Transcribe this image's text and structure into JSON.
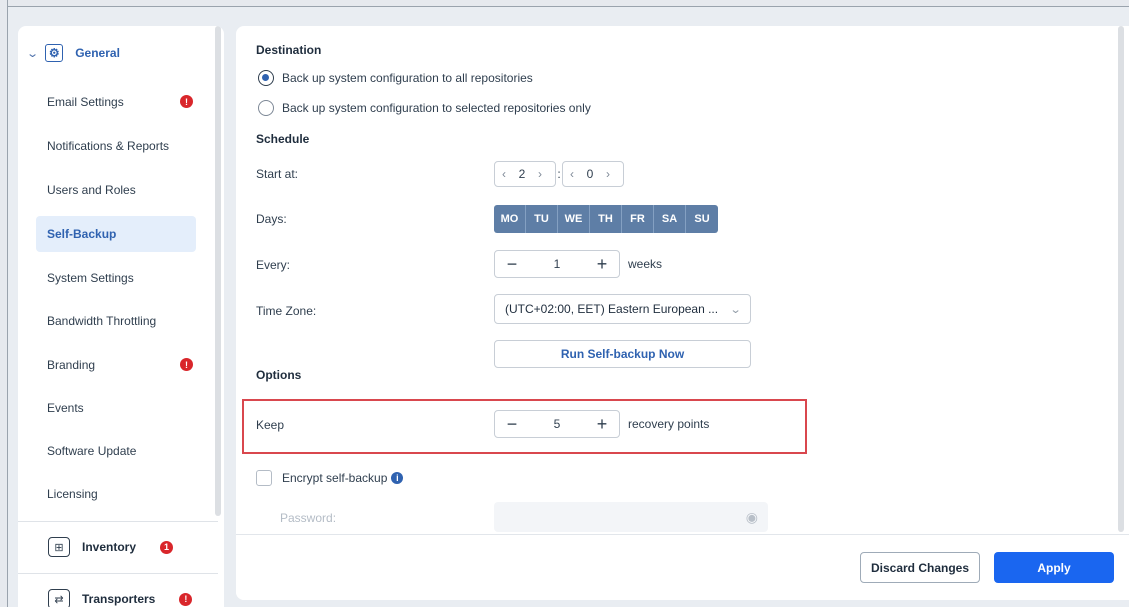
{
  "sidebar": {
    "general": {
      "label": "General",
      "expanded_icon": "chevron-down-icon",
      "icon": "gear-icon"
    },
    "items": [
      {
        "label": "Email Settings",
        "alert": "!"
      },
      {
        "label": "Notifications & Reports"
      },
      {
        "label": "Users and Roles"
      },
      {
        "label": "Self-Backup",
        "active": true
      },
      {
        "label": "System Settings"
      },
      {
        "label": "Bandwidth Throttling"
      },
      {
        "label": "Branding",
        "alert": "!"
      },
      {
        "label": "Events"
      },
      {
        "label": "Software Update"
      },
      {
        "label": "Licensing"
      }
    ],
    "inventory": {
      "label": "Inventory",
      "alert": "1",
      "icon": "inventory-icon"
    },
    "transporters": {
      "label": "Transporters",
      "alert": "!",
      "icon": "transporters-icon"
    }
  },
  "destination": {
    "title": "Destination",
    "option_all": "Back up system configuration to all repositories",
    "option_selected": "Back up system configuration to selected repositories only",
    "selected": "all"
  },
  "schedule": {
    "title": "Schedule",
    "start_label": "Start at:",
    "start_hour": "2",
    "start_minute": "0",
    "time_separator": ":",
    "days_label": "Days:",
    "days": [
      "MO",
      "TU",
      "WE",
      "TH",
      "FR",
      "SA",
      "SU"
    ],
    "every_label": "Every:",
    "every_value": "1",
    "every_unit": "weeks",
    "timezone_label": "Time Zone:",
    "timezone_value": "(UTC+02:00, EET) Eastern European ...",
    "run_now": "Run Self-backup Now"
  },
  "options": {
    "title": "Options",
    "keep_label": "Keep",
    "keep_value": "5",
    "keep_unit": "recovery points",
    "encrypt_label": "Encrypt self-backup",
    "password_label": "Password:"
  },
  "footer": {
    "discard": "Discard Changes",
    "apply": "Apply"
  },
  "colors": {
    "accent": "#1a66f0",
    "link": "#2f62b0",
    "days_bg": "#5e7ea6",
    "alert": "#d9262b",
    "highlight": "#d9474e"
  }
}
